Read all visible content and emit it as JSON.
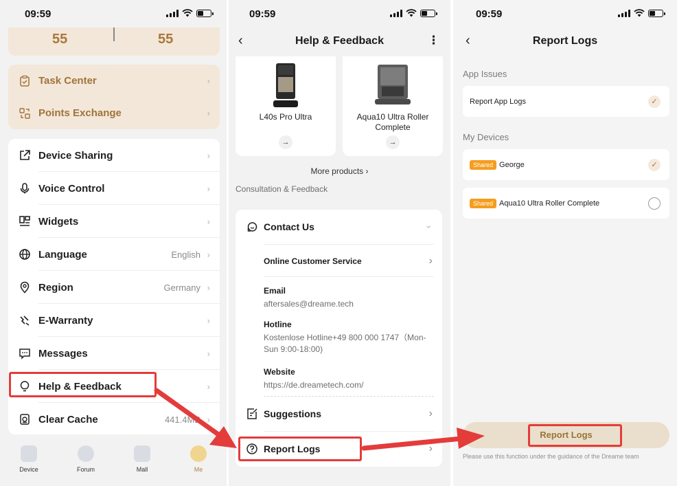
{
  "status_bar": {
    "time": "09:59"
  },
  "profile_screen": {
    "points": [
      "55",
      "55"
    ],
    "gold_items": [
      {
        "label": "Task Center",
        "icon": "clipboard-check-icon"
      },
      {
        "label": "Points Exchange",
        "icon": "exchange-icon"
      }
    ],
    "menu_items": [
      {
        "label": "Device Sharing",
        "value": "",
        "icon": "share-icon"
      },
      {
        "label": "Voice Control",
        "value": "",
        "icon": "microphone-icon"
      },
      {
        "label": "Widgets",
        "value": "",
        "icon": "widgets-icon"
      },
      {
        "label": "Language",
        "value": "English",
        "icon": "globe-icon"
      },
      {
        "label": "Region",
        "value": "Germany",
        "icon": "location-pin-icon"
      },
      {
        "label": "E-Warranty",
        "value": "",
        "icon": "warranty-icon"
      },
      {
        "label": "Messages",
        "value": "",
        "icon": "message-icon"
      },
      {
        "label": "Help & Feedback",
        "value": "",
        "icon": "lightbulb-icon"
      },
      {
        "label": "Clear Cache",
        "value": "441.4MB",
        "icon": "cache-icon"
      }
    ],
    "tabs": [
      {
        "label": "Device",
        "icon": "device-tab-icon"
      },
      {
        "label": "Forum",
        "icon": "forum-tab-icon"
      },
      {
        "label": "Mall",
        "icon": "mall-tab-icon"
      },
      {
        "label": "Me",
        "icon": "me-tab-icon"
      }
    ]
  },
  "help_screen": {
    "title": "Help & Feedback",
    "back_glyph": "‹",
    "more_glyph": "⋮",
    "products": [
      {
        "name": "L40s Pro Ultra"
      },
      {
        "name": "Aqua10 Ultra Roller Complete"
      }
    ],
    "arrow_glyph": "→",
    "more_products": "More products ›",
    "section_label": "Consultation & Feedback",
    "contact_us": "Contact Us",
    "online_service": "Online Customer Service",
    "email_title": "Email",
    "email_value": "aftersales@dreame.tech",
    "hotline_title": "Hotline",
    "hotline_value": "Kostenlose Hotline+49 800 000 1747（Mon-Sun 9:00-18:00)",
    "website_title": "Website",
    "website_value": "https://de.dreametech.com/",
    "suggestions": "Suggestions",
    "report_logs": "Report Logs"
  },
  "report_screen": {
    "title": "Report Logs",
    "back_glyph": "‹",
    "app_issues_label": "App Issues",
    "app_logs_option": "Report App Logs",
    "my_devices_label": "My Devices",
    "shared_badge": "Shared",
    "devices": [
      {
        "name": "George",
        "selected": true
      },
      {
        "name": "Aqua10 Ultra Roller Complete",
        "selected": false
      }
    ],
    "check_glyph": "✓",
    "button_label": "Report Logs",
    "note": "Please use this function under the guidance of the Dreame team"
  },
  "colors": {
    "accent_gold": "#a8783c",
    "annotation_red": "#e43b3b",
    "shared_badge": "#f59d1e"
  }
}
